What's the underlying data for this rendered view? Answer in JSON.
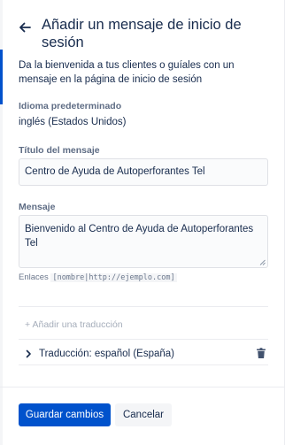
{
  "header": {
    "title": "Añadir un mensaje de inicio de sesión",
    "back_icon": "arrow-left-icon"
  },
  "intro": "Da la bienvenida a tus clientes o guíales con un mensaje en la página de inicio de sesión",
  "default_language": {
    "label": "Idioma predeterminado",
    "value": "inglés (Estados Unidos)"
  },
  "message_title": {
    "label": "Título del mensaje",
    "value": "Centro de Ayuda de Autoperforantes Tel"
  },
  "message": {
    "label": "Mensaje",
    "value": "Bienvenido al Centro de Ayuda de Autoperforantes Tel"
  },
  "links_hint": {
    "prefix": "Enlaces",
    "code": "[nombre|http://ejemplo.com]"
  },
  "add_translation": "+ Añadir una traducción",
  "translation": {
    "label": "Traducción: español (España)",
    "expand_icon": "chevron-right-icon",
    "delete_icon": "trash-icon"
  },
  "buttons": {
    "save": "Guardar cambios",
    "cancel": "Cancelar"
  },
  "colors": {
    "primary": "#0052cc",
    "text": "#172b4d",
    "muted": "#5e6c84"
  }
}
